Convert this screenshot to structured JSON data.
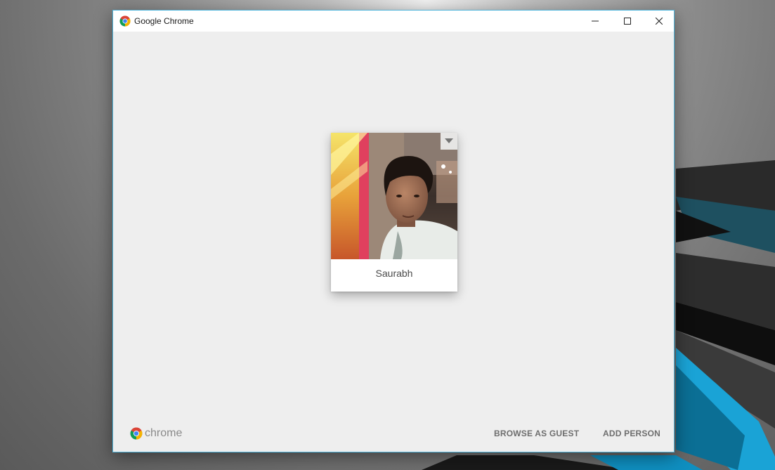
{
  "window": {
    "title": "Google Chrome",
    "controls": {
      "minimize": "minimize-icon",
      "maximize": "maximize-icon",
      "close": "close-icon"
    },
    "border_color": "#4fb3d9"
  },
  "profile": {
    "name": "Saurabh",
    "menu_icon": "dropdown-arrow-icon"
  },
  "footer": {
    "logo_text": "chrome",
    "browse_as_guest": "BROWSE AS GUEST",
    "add_person": "ADD PERSON"
  },
  "colors": {
    "background": "#eeeeee",
    "button_text": "#6e6e6e",
    "chrome_red": "#db4437",
    "chrome_green": "#0f9d58",
    "chrome_yellow": "#f4b400",
    "chrome_blue": "#4285f4"
  }
}
